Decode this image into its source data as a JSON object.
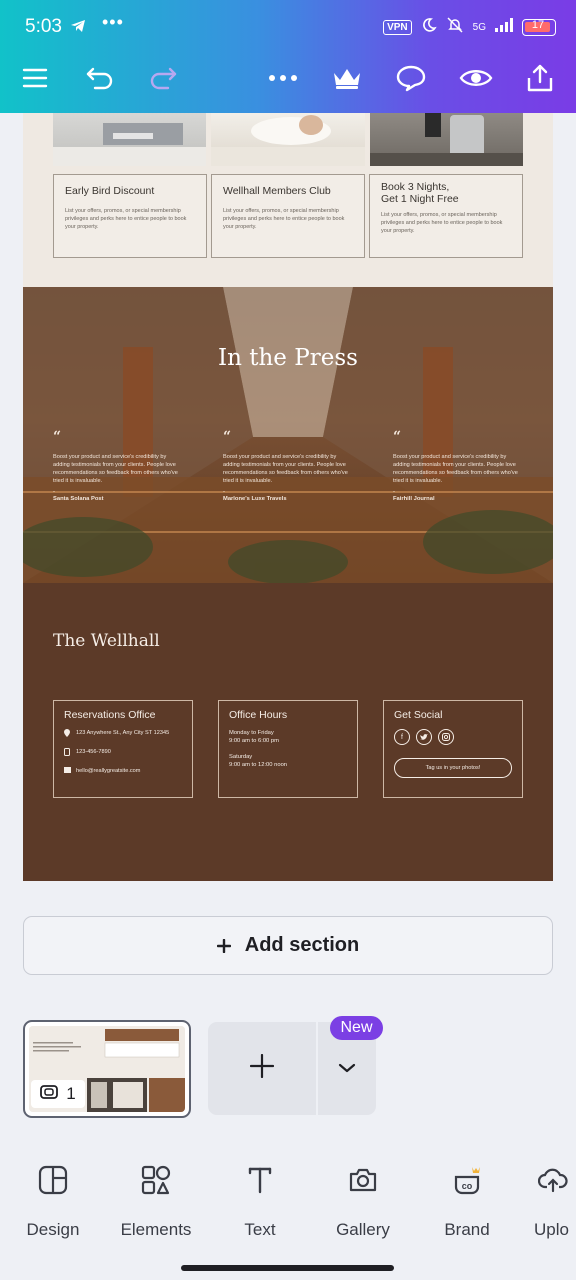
{
  "status_bar": {
    "time": "5:03",
    "more": "•••",
    "vpn": "VPN",
    "network": "5G",
    "battery": "17"
  },
  "toolbar": {
    "icons": [
      "menu-icon",
      "undo-icon",
      "redo-icon",
      "more-icon",
      "crown-icon",
      "comment-icon",
      "preview-icon",
      "share-icon"
    ]
  },
  "design": {
    "offers": [
      {
        "title": "Early Bird Discount",
        "body": "List your offers, promos, or special membership privileges and perks here to entice people to book your property."
      },
      {
        "title": "Wellhall Members Club",
        "body": "List your offers, promos, or special membership privileges and perks here to entice people to book your property."
      },
      {
        "title": "Book 3 Nights,\nGet 1 Night Free",
        "body": "List your offers, promos, or special membership privileges and perks here to entice people to book your property."
      }
    ],
    "press": {
      "title": "In the Press",
      "quotes": [
        {
          "mark": "“",
          "text": "Boost your product and service's credibility by adding testimonials from your clients. People love recommendations so feedback from others who've tried it is invaluable.",
          "dash": "-",
          "source": "Santa Solana Post"
        },
        {
          "mark": "“",
          "text": "Boost your product and service's credibility by adding testimonials from your clients. People love recommendations so feedback from others who've tried it is invaluable.",
          "dash": "-",
          "source": "Marlone's Luxe Travels"
        },
        {
          "mark": "“",
          "text": "Boost your product and service's credibility by adding testimonials from your clients. People love recommendations so feedback from others who've tried it is invaluable.",
          "dash": "-",
          "source": "Fairhill Journal"
        }
      ]
    },
    "footer": {
      "brand": "The Wellhall",
      "reservations": {
        "title": "Reservations Office",
        "address": "123 Anywhere St., Any City ST 12345",
        "phone": "123-456-7890",
        "email": "hello@reallygreatsite.com"
      },
      "hours": {
        "title": "Office Hours",
        "weekday_label": "Monday to Friday",
        "weekday_time": "9:00 am to 6:00 pm",
        "saturday_label": "Saturday",
        "saturday_time": "9:00 am to 12:00 noon"
      },
      "social": {
        "title": "Get Social",
        "icons": [
          "facebook-icon",
          "twitter-icon",
          "instagram-icon"
        ],
        "button": "Tag us in your photos!"
      }
    }
  },
  "add_section": {
    "label": "Add section"
  },
  "pages": {
    "count": "1",
    "new_badge": "New"
  },
  "bottom_nav": {
    "items": [
      {
        "label": "Design",
        "icon": "design-icon"
      },
      {
        "label": "Elements",
        "icon": "elements-icon"
      },
      {
        "label": "Text",
        "icon": "text-icon"
      },
      {
        "label": "Gallery",
        "icon": "camera-icon"
      },
      {
        "label": "Brand",
        "icon": "brand-icon"
      },
      {
        "label": "Uplo",
        "icon": "upload-icon"
      }
    ]
  },
  "colors": {
    "accent": "#7b3fe4",
    "footer_bg": "#5c3a28",
    "offers_bg": "#efe9e2"
  }
}
